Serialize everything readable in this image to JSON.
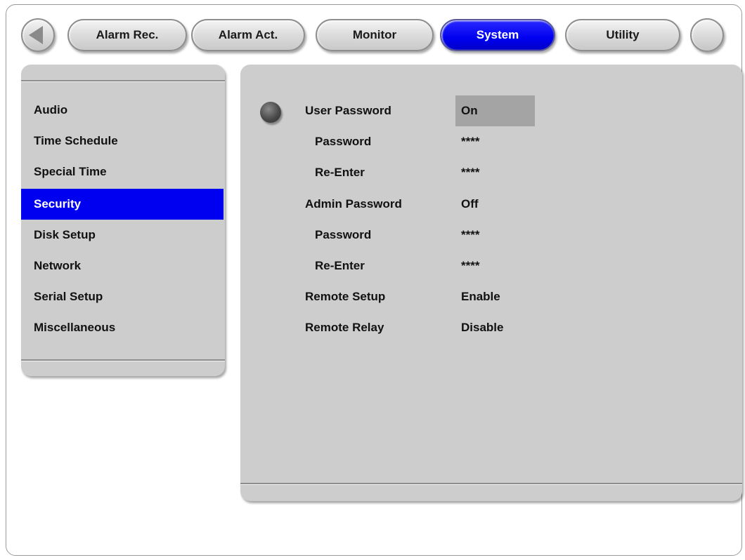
{
  "tabs": [
    {
      "label": "Alarm Rec."
    },
    {
      "label": "Alarm Act."
    },
    {
      "label": "Monitor"
    },
    {
      "label": "System"
    },
    {
      "label": "Utility"
    }
  ],
  "active_tab": "System",
  "colors": {
    "accent": "#0000f0",
    "panel": "#cdcdcd",
    "focus": "#a4a4a4"
  },
  "icons": {
    "back": "triangle-left-icon",
    "bullet": "selection-bullet-icon"
  },
  "sidebar": {
    "items": [
      {
        "label": "Audio"
      },
      {
        "label": "Time Schedule"
      },
      {
        "label": "Special Time"
      },
      {
        "label": "Security"
      },
      {
        "label": "Disk Setup"
      },
      {
        "label": "Network"
      },
      {
        "label": "Serial Setup"
      },
      {
        "label": "Miscellaneous"
      }
    ],
    "selected": "Security"
  },
  "settings": [
    {
      "label": "User Password",
      "value": "On"
    },
    {
      "label": "Password",
      "value": "****"
    },
    {
      "label": "Re-Enter",
      "value": "****"
    },
    {
      "label": "Admin Password",
      "value": "Off"
    },
    {
      "label": "Password",
      "value": "****"
    },
    {
      "label": "Re-Enter",
      "value": "****"
    },
    {
      "label": "Remote Setup",
      "value": "Enable"
    },
    {
      "label": "Remote Relay",
      "value": "Disable"
    }
  ]
}
